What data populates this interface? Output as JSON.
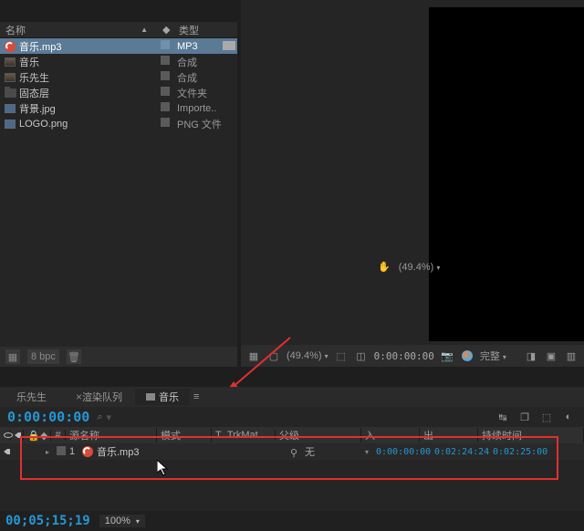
{
  "project": {
    "columns": {
      "name": "名称",
      "type": "类型"
    },
    "items": [
      {
        "icon": "mp3",
        "name": "音乐.mp3",
        "type": "MP3",
        "selected": true,
        "flow": true
      },
      {
        "icon": "comp",
        "name": "音乐",
        "type": "合成"
      },
      {
        "icon": "comp",
        "name": "乐先生",
        "type": "合成"
      },
      {
        "icon": "folder",
        "name": "固态层",
        "type": "文件夹"
      },
      {
        "icon": "img",
        "name": "背景.jpg",
        "type": "Importe.."
      },
      {
        "icon": "img",
        "name": "LOGO.png",
        "type": "PNG 文件"
      }
    ],
    "footer": {
      "bpc": "8 bpc"
    }
  },
  "viewer": {
    "zoom": "(49.4%)",
    "zoom2": "(49.4%)",
    "timecode": "0:00:00:00",
    "resolution": "完整"
  },
  "timeline": {
    "tabs": [
      {
        "label": "乐先生",
        "active": false
      },
      {
        "label": "渲染队列",
        "active": false,
        "closable": true
      },
      {
        "label": "音乐",
        "active": true,
        "icon": true
      }
    ],
    "current_time": "0:00:00:00",
    "columns": {
      "source": "源名称",
      "mode": "模式",
      "trkmat_t": "T",
      "trkmat": "TrkMat",
      "parent": "父级",
      "in": "入",
      "out": "出",
      "duration": "持续时间"
    },
    "layers": [
      {
        "index": "1",
        "name": "音乐.mp3",
        "icon": "mp3",
        "parent": "无",
        "in": "0:00:00:00",
        "out": "0:02:24:24",
        "duration": "0:02:25:00"
      }
    ],
    "idx_sym": "#"
  },
  "bottom": {
    "timecode": "00;05;15;19",
    "zoom": "100%"
  },
  "icons": {
    "search": "search",
    "tag": "tag",
    "trash": "trash",
    "camera": "camera"
  }
}
